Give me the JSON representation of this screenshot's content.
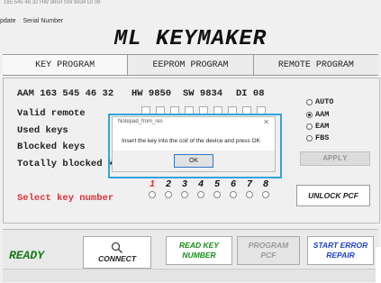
{
  "window": {
    "title_strip": "165 545 46 32  HW 9850  SW 9834  DI 08",
    "menu": [
      "pdate",
      "Serial Number"
    ]
  },
  "app_title": "ML KEYMAKER",
  "tabs": [
    "KEY PROGRAM",
    "EEPROM PROGRAM",
    "REMOTE PROGRAM"
  ],
  "info": {
    "aam": "AAM 163 545 46 32",
    "hw": "HW 9850",
    "sw": "SW 9834",
    "di": "DI 08"
  },
  "labels": {
    "valid_remote": "Valid remote",
    "used_keys": "Used keys",
    "blocked_keys": "Blocked keys",
    "totally_blocked": "Totally blocked ke",
    "select_key": "Select key number"
  },
  "modes": [
    {
      "label": "AUTO",
      "selected": false
    },
    {
      "label": "AAM",
      "selected": true
    },
    {
      "label": "EAM",
      "selected": false
    },
    {
      "label": "FBS",
      "selected": false
    }
  ],
  "apply_label": "APPLY",
  "key_numbers": [
    "1",
    "2",
    "3",
    "4",
    "5",
    "6",
    "7",
    "8"
  ],
  "unlock_label": "UNLOCK PCF",
  "status": {
    "ready": "READY"
  },
  "bottom_buttons": {
    "connect": "CONNECT",
    "read_key": [
      "READ KEY",
      "NUMBER"
    ],
    "program": [
      "PROGRAM",
      "PCF"
    ],
    "start_error": [
      "START ERROR",
      "REPAIR"
    ]
  },
  "dialog": {
    "title": "Notepad_from_res",
    "message": "Insert the key into the coil of the device and press OK",
    "ok_label": "OK",
    "close_glyph": "✕"
  },
  "colors": {
    "ready": "#1a7a1a",
    "red_number": "#e0303a",
    "blue_button": "#1f3fcf",
    "green_button": "#1a8a1a",
    "dialog_border": "#31a3e0"
  },
  "icons": {
    "connect": "magnifier-icon",
    "dialog_close": "close-icon"
  }
}
